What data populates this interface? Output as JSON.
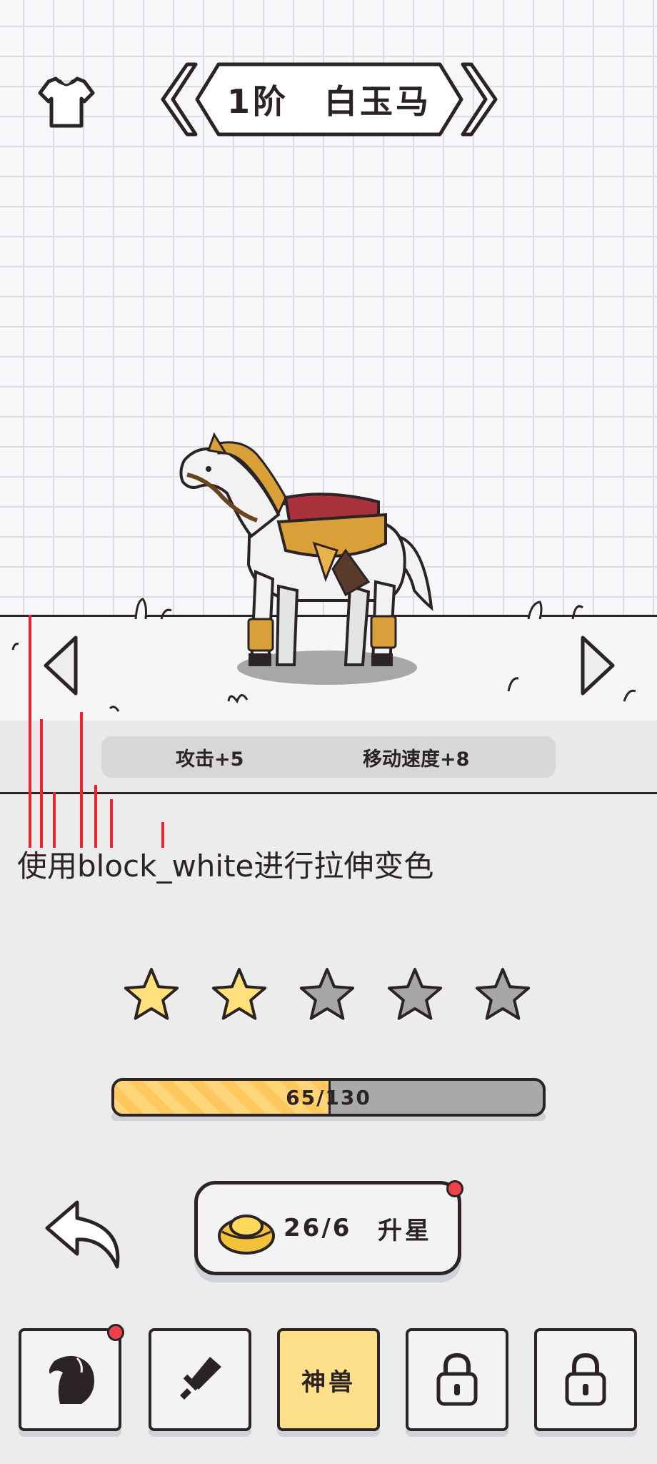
{
  "header": {
    "title": "1阶 白玉马"
  },
  "mount": {
    "name": "白玉马"
  },
  "stats": {
    "attack": "攻击+5",
    "move_speed": "移动速度+8"
  },
  "dev_note": "使用block_white进行拉伸变色",
  "stars": {
    "total": 5,
    "filled": 2,
    "filled_color": "#ffe07a",
    "empty_color": "#a6a6a8"
  },
  "progress": {
    "current": 65,
    "max": 130,
    "label": "65/130"
  },
  "upgrade": {
    "count": "26/6",
    "label": "升星"
  },
  "tabs": [
    {
      "name": "horse",
      "label": ""
    },
    {
      "name": "weapon",
      "label": ""
    },
    {
      "name": "beast",
      "label": "神兽",
      "active": true
    },
    {
      "name": "locked-1",
      "label": ""
    },
    {
      "name": "locked-2",
      "label": ""
    }
  ],
  "colors": {
    "outline": "#2b2324",
    "accent_yellow": "#ffe08a",
    "badge_red": "#f0414a",
    "debug_red": "#f0202c"
  }
}
